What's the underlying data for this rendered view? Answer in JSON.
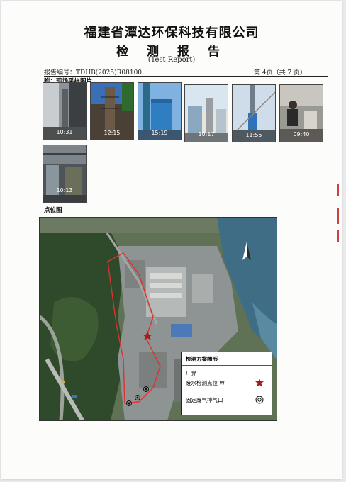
{
  "header": {
    "company": "福建省潭达环保科技有限公司",
    "title": "检 测 报 告",
    "subtitle": "(Test Report)",
    "report_no": "报告编号：TDHB(2025)R08100",
    "page_info": "第 4页（共 7 页）"
  },
  "sections": {
    "photos_label": "附：现场采样图片",
    "map_label": "点位图"
  },
  "photos": [
    {
      "time": "10:31"
    },
    {
      "time": "12:15"
    },
    {
      "time": "15:19"
    },
    {
      "time": "10:17"
    },
    {
      "time": "11:55"
    },
    {
      "time": "09:40"
    },
    {
      "time": "10:13"
    }
  ],
  "map": {
    "legend": {
      "title": "检测方案图形",
      "items": [
        {
          "label": "厂界",
          "symbol": "red-line"
        },
        {
          "label": "废水检测点位 W",
          "symbol": "star-icon"
        },
        {
          "label": "固定废气排气口",
          "symbol": "double-circle-icon"
        }
      ]
    },
    "colors": {
      "boundary": "#e03030",
      "star": "#b01818"
    }
  }
}
